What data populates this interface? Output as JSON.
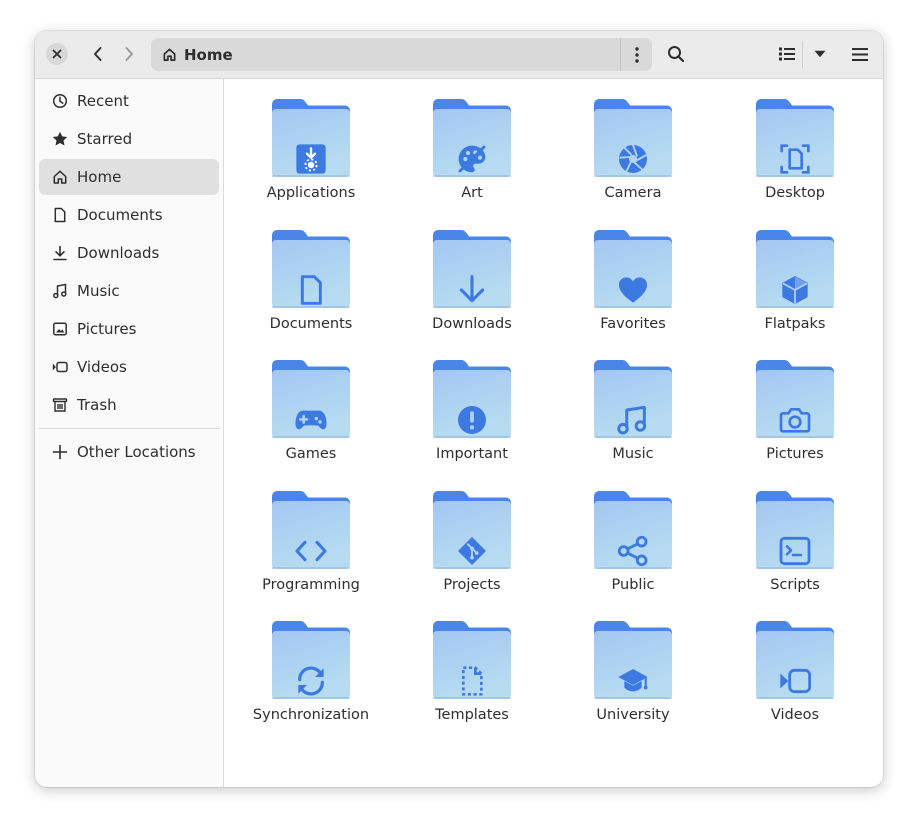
{
  "header": {
    "location": "Home",
    "icons": {
      "close": "close-icon",
      "back": "go-back-icon",
      "forward": "go-forward-icon",
      "home": "home-icon",
      "location_menu": "vertical-ellipsis-icon",
      "search": "search-icon",
      "view": "list-view-icon",
      "sort": "chevron-down-icon",
      "main_menu": "hamburger-menu-icon"
    }
  },
  "sidebar": {
    "items": [
      {
        "label": "Recent",
        "icon": "clock-icon"
      },
      {
        "label": "Starred",
        "icon": "star-icon"
      },
      {
        "label": "Home",
        "icon": "home-icon",
        "active": true
      },
      {
        "label": "Documents",
        "icon": "document-icon"
      },
      {
        "label": "Downloads",
        "icon": "download-icon"
      },
      {
        "label": "Music",
        "icon": "music-note-icon"
      },
      {
        "label": "Pictures",
        "icon": "image-icon"
      },
      {
        "label": "Videos",
        "icon": "video-camera-icon"
      },
      {
        "label": "Trash",
        "icon": "trash-icon"
      }
    ],
    "other_locations": {
      "label": "Other Locations",
      "icon": "plus-icon"
    }
  },
  "folders": [
    {
      "name": "Applications",
      "icon": "app-install-icon"
    },
    {
      "name": "Art",
      "icon": "palette-icon"
    },
    {
      "name": "Camera",
      "icon": "aperture-icon"
    },
    {
      "name": "Desktop",
      "icon": "desktop-frame-icon"
    },
    {
      "name": "Documents",
      "icon": "document-icon"
    },
    {
      "name": "Downloads",
      "icon": "download-arrow-icon"
    },
    {
      "name": "Favorites",
      "icon": "heart-icon"
    },
    {
      "name": "Flatpaks",
      "icon": "package-cube-icon"
    },
    {
      "name": "Games",
      "icon": "gamepad-icon"
    },
    {
      "name": "Important",
      "icon": "exclamation-icon"
    },
    {
      "name": "Music",
      "icon": "music-note-icon"
    },
    {
      "name": "Pictures",
      "icon": "camera-icon"
    },
    {
      "name": "Programming",
      "icon": "code-brackets-icon"
    },
    {
      "name": "Projects",
      "icon": "git-icon"
    },
    {
      "name": "Public",
      "icon": "share-icon"
    },
    {
      "name": "Scripts",
      "icon": "terminal-icon"
    },
    {
      "name": "Synchronization",
      "icon": "sync-icon"
    },
    {
      "name": "Templates",
      "icon": "template-document-icon"
    },
    {
      "name": "University",
      "icon": "graduation-cap-icon"
    },
    {
      "name": "Videos",
      "icon": "video-camera-icon"
    }
  ],
  "colors": {
    "folder_tab": "#4a86e8",
    "folder_body_top": "#a3c7f1",
    "folder_body_bottom": "#b7dcf1",
    "folder_glyph": "#3c79e0",
    "headerbar": "#ebebeb",
    "sidebar": "#fafafa",
    "sidebar_active": "#e0e0e0"
  }
}
